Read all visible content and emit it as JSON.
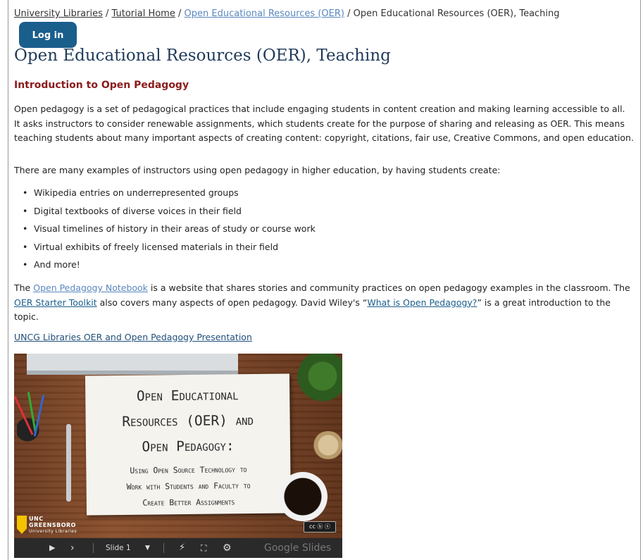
{
  "breadcrumb": {
    "items": [
      "University Libraries",
      "Tutorial Home",
      "Open Educational Resources (OER)"
    ],
    "separator": "/",
    "current": "Open Educational Resources (OER), Teaching"
  },
  "login_button": "Log in",
  "page_title": "Open Educational Resources (OER), Teaching",
  "section": {
    "heading": "Introduction to Open Pedagogy",
    "paragraph1": "Open pedagogy is a set of pedagogical practices that include engaging students in content creation and making learning accessible to all. It asks instructors to consider renewable assignments, which students create for the purpose of sharing and releasing as OER. This means teaching students about many important aspects of creating content: copyright, citations, fair use, Creative Commons, and open education.",
    "paragraph2": "There are many examples of instructors using open pedagogy in higher education, by having students create:",
    "examples": [
      "Wikipedia entries on underrepresented groups",
      "Digital textbooks of diverse voices in their field",
      "Visual timelines of history in their areas of study or course work",
      "Virtual exhibits of freely licensed materials in their field",
      "And more!"
    ],
    "paragraph3": {
      "t1": "The ",
      "link1": "Open Pedagogy Notebook",
      "t2": " is a website that shares stories and community practices on open pedagogy examples in the classroom. The ",
      "link2": "OER Starter Toolkit",
      "t3": " also covers many aspects of open pedagogy. David Wiley's “",
      "link3": "What is Open Pedagogy?",
      "t4": "” is a great introduction to the topic."
    },
    "presentation_link": " UNCG Libraries OER and Open Pedagogy Presentation"
  },
  "slide": {
    "title_lines": [
      "Open Educational",
      "Resources (OER) and",
      "Open Pedagogy:"
    ],
    "subtitle_lines": [
      "Using Open Source Technology to",
      "Work with Students and Faculty to",
      "Create Better Assignments"
    ],
    "logo_lines": [
      "UNC",
      "GREENSBORO",
      "University Libraries"
    ],
    "cc_badge": "cc ⓑ ⓢ",
    "controls": {
      "slide_label": "Slide 1",
      "brand": "Google Slides"
    }
  }
}
